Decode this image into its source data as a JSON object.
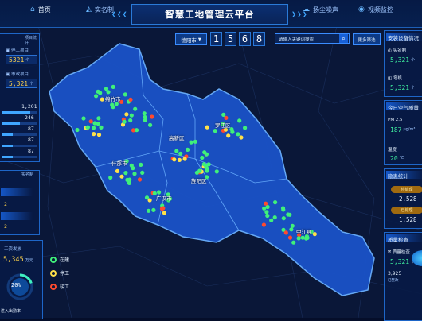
{
  "header": {
    "nav_left": [
      {
        "label": "首页",
        "icon": "home-icon"
      },
      {
        "label": "实名制",
        "icon": "person-card-icon"
      }
    ],
    "title": "智慧工地管理云平台",
    "nav_right": [
      {
        "label": "扬尘噪声",
        "icon": "cloud-icon"
      },
      {
        "label": "视频监控",
        "icon": "camera-icon"
      }
    ]
  },
  "toolbar": {
    "city": "德阳市",
    "counter_digits": [
      "1",
      "5",
      "6",
      "8"
    ],
    "search_placeholder": "请输入关键词搜索",
    "more_label": "更多筛选"
  },
  "left_panel": {
    "tag_top": "项目统计",
    "stopped_label": "停工项目",
    "stopped_value": "5321",
    "stopped_unit": "个",
    "municipal_label": "市政项目",
    "municipal_value": "5,321",
    "municipal_unit": "个",
    "list_values": [
      "1,201",
      "246",
      "87",
      "87",
      "87"
    ],
    "list_bars": [
      0.8,
      0.5,
      0.3,
      0.3,
      0.3
    ],
    "mid_tag": "实名制",
    "mid_values": [
      "2",
      "2"
    ],
    "bottom_tag": "工资发放",
    "wage_label": "工资发放",
    "wage_value": "5,345",
    "wage_unit": "万元",
    "percent": "20%",
    "percent_label": "进入出勤率"
  },
  "legend": [
    {
      "label": "在建",
      "color": "#3ff07a"
    },
    {
      "label": "停工",
      "color": "#ffe14a"
    },
    {
      "label": "竣工",
      "color": "#ff4a2e"
    }
  ],
  "districts": [
    "旌阳区",
    "高新区",
    "罗江区",
    "绵竹市",
    "什邡市",
    "中江县",
    "广汉市"
  ],
  "right_panel": {
    "device_title": "安装设备情况",
    "realname_label": "实名制",
    "realname_value": "5,321",
    "realname_unit": "个",
    "noise_label": "塔机",
    "noise_value": "5,321",
    "noise_unit": "个",
    "air_title": "今日空气质量",
    "pm_label": "PM 2.5",
    "pm_value": "187",
    "pm_unit": "μg/m³",
    "temp_label": "温度",
    "temp_value": "20",
    "temp_unit": "℃",
    "warn_title": "隐患统计",
    "warn_items": [
      {
        "label": "待处理",
        "value": "2,528"
      },
      {
        "label": "已处理",
        "value": "1,528"
      }
    ],
    "inspect_title": "质量检查",
    "inspect_label": "质量检查",
    "inspect_value": "5,321",
    "inspect_unit": "个",
    "inspect_small": "3,925",
    "inspect_small_label": "已整改"
  }
}
